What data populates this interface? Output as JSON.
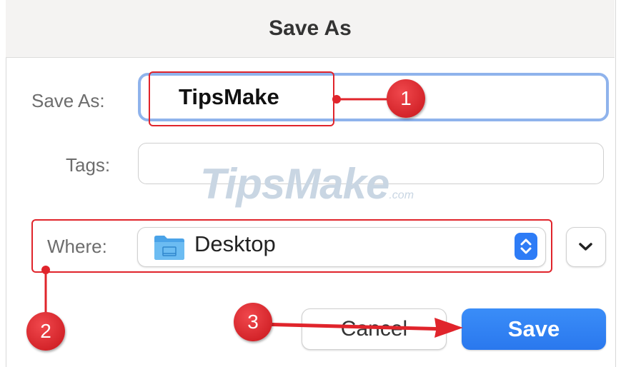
{
  "dialog": {
    "title": "Save As",
    "save_as_label": "Save As:",
    "save_as_value": "TipsMake",
    "tags_label": "Tags:",
    "tags_value": "",
    "where_label": "Where:",
    "where_value": "Desktop",
    "cancel_label": "Cancel",
    "save_label": "Save"
  },
  "watermark": {
    "text": "TipsMake",
    "domain": ".com"
  },
  "annotations": [
    "1",
    "2",
    "3"
  ],
  "icons": {
    "folder": "folder-icon",
    "stepper": "up-down-chevron-icon",
    "expand": "chevron-down-icon"
  },
  "colors": {
    "accent": "#2e7cf6",
    "focus_ring": "#8fb3ec",
    "annotation_red": "#e0242b"
  }
}
